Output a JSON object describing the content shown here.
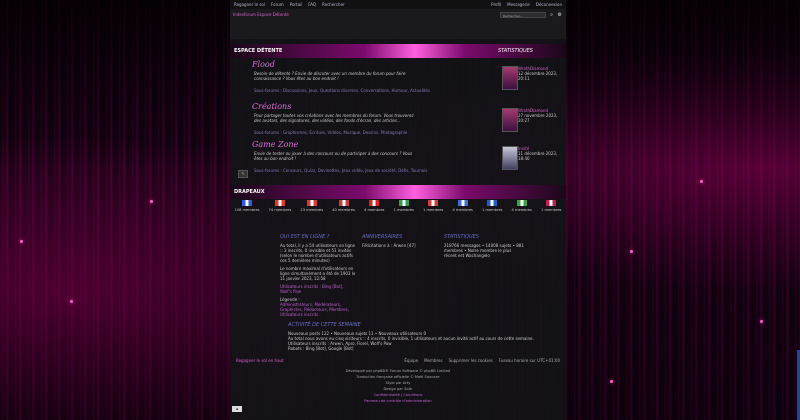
{
  "topbar": {
    "left": [
      "Regagner le sol",
      "Forum",
      "Portail",
      "FAQ",
      "Rechercher"
    ],
    "right": [
      "Profil",
      "Messagerie",
      "Déconnexion"
    ]
  },
  "breadcrumb": "Indexforum Espace Détente",
  "search": {
    "placeholder": "Rechercher..."
  },
  "categories": {
    "detente": {
      "label": "ESPACE DÉTENTE",
      "right_label": "STATISTIQUES"
    },
    "drapeaux": {
      "label": "DRAPEAUX"
    }
  },
  "forums": [
    {
      "title": "Flood",
      "desc": "Besoin de détente ? Envie de discuter avec un membre du forum pour faire connaissance ? Vous êtes au bon endroit !",
      "sub": "Sous-forums : Discussions, Jeux, Questions diverses, Conversations, Humour, Actualités",
      "last_who": "WrathDiamond",
      "last_date": "12 décembre 2023, 20:11"
    },
    {
      "title": "Créations",
      "desc": "Pour partager toutes vos créations avec les membres du forum. Vous trouverez des avatars, des signatures, des vidéos, des fonds d'écran, des articles...",
      "sub": "Sous-forums : Graphismes, Écriture, Vidéos, Musique, Dessins, Photographie",
      "last_who": "WrathDiamond",
      "last_date": "27 novembre 2023, 20:27"
    },
    {
      "title": "Game Zone",
      "desc": "Envie de tester ou jouer à des concours ou de participer à des concours ? Vous êtes au bon endroit !",
      "sub": "Sous-forums : Concours, Quizz, Devinettes, Jeux vidéo, Jeux de société, Défis, Tournois",
      "last_who": "Invité",
      "last_date": "11 décembre 2023, 18:40"
    }
  ],
  "flags": [
    {
      "label": "108 membres",
      "color": "#2a5fd8"
    },
    {
      "label": "74 membres",
      "color": "#e03a2a"
    },
    {
      "label": "23 membres",
      "color": "#d83a3a"
    },
    {
      "label": "40 membres",
      "color": "#c04040"
    },
    {
      "label": "4 membres",
      "color": "#e02020"
    },
    {
      "label": "1 membres",
      "color": "#30a050"
    },
    {
      "label": "1 membres",
      "color": "#d04040"
    },
    {
      "label": "4 membres",
      "color": "#3a70d0"
    },
    {
      "label": "1 membres",
      "color": "#2060c0"
    },
    {
      "label": "4 membres",
      "color": "#40a040"
    },
    {
      "label": "1 membres",
      "color": "#c02050"
    }
  ],
  "online": {
    "heading": "QUI EST EN LIGNE ?",
    "body1": "Au total, il y a 54 utilisateurs en ligne :: 3 inscrits, 0 invisible et 51 invités (selon le nombre d'utilisateurs actifs ces 5 dernières minutes)",
    "body2": "Le nombre maximal d'utilisateurs en ligne simultanément a été de 1903 le 11 janvier 2023, 12:58",
    "users_label": "Utilisateurs inscrits : Bing [Bot], Wolf's Paw",
    "legend_label": "Légende :",
    "legend": "Administrateurs, Modérateurs, Graphistes, Rédacteurs, Membres, Utilisateurs inscrits"
  },
  "birthdays": {
    "heading": "ANNIVERSAIRES",
    "body": "Félicitations à : Arwen [47]"
  },
  "stats": {
    "heading": "STATISTIQUES",
    "body": "218766 messages • 14008 sujets • 881 membres • Notre membre le plus récent est Wachangelo"
  },
  "activity": {
    "heading": "ACTIVITÉ DE CETTE SEMAINE",
    "line1": "Nouveaux posts 122 • Nouveaux sujets 11 • Nouveaux utilisateurs 0",
    "line2": "Au total nous avons eu cinq visiteurs :: 4 inscrits, 0 invisible, 1 utilisateurs et aucun invité actif au cours de cette semaine.",
    "line3": "Utilisateurs inscrits : Arwen, Apro, Fiorel, Wolf's Paw",
    "line4": "Robots : Bing [Bot], Google [Bot]"
  },
  "bottombar": {
    "left": "Regagner le sol en haut",
    "right": [
      "Équipe",
      "Membres",
      "Supprimer les cookies",
      "Fuseau horaire sur UTC+01:00"
    ]
  },
  "footer": [
    "Développé par phpBB® Forum Software © phpBB Limited",
    "Traduction française officielle © Maël Soucaze",
    "Style par Arty",
    "Design par SoAr",
    "Confidentialité | Conditions",
    "Panneau de contrôle d'administration"
  ]
}
